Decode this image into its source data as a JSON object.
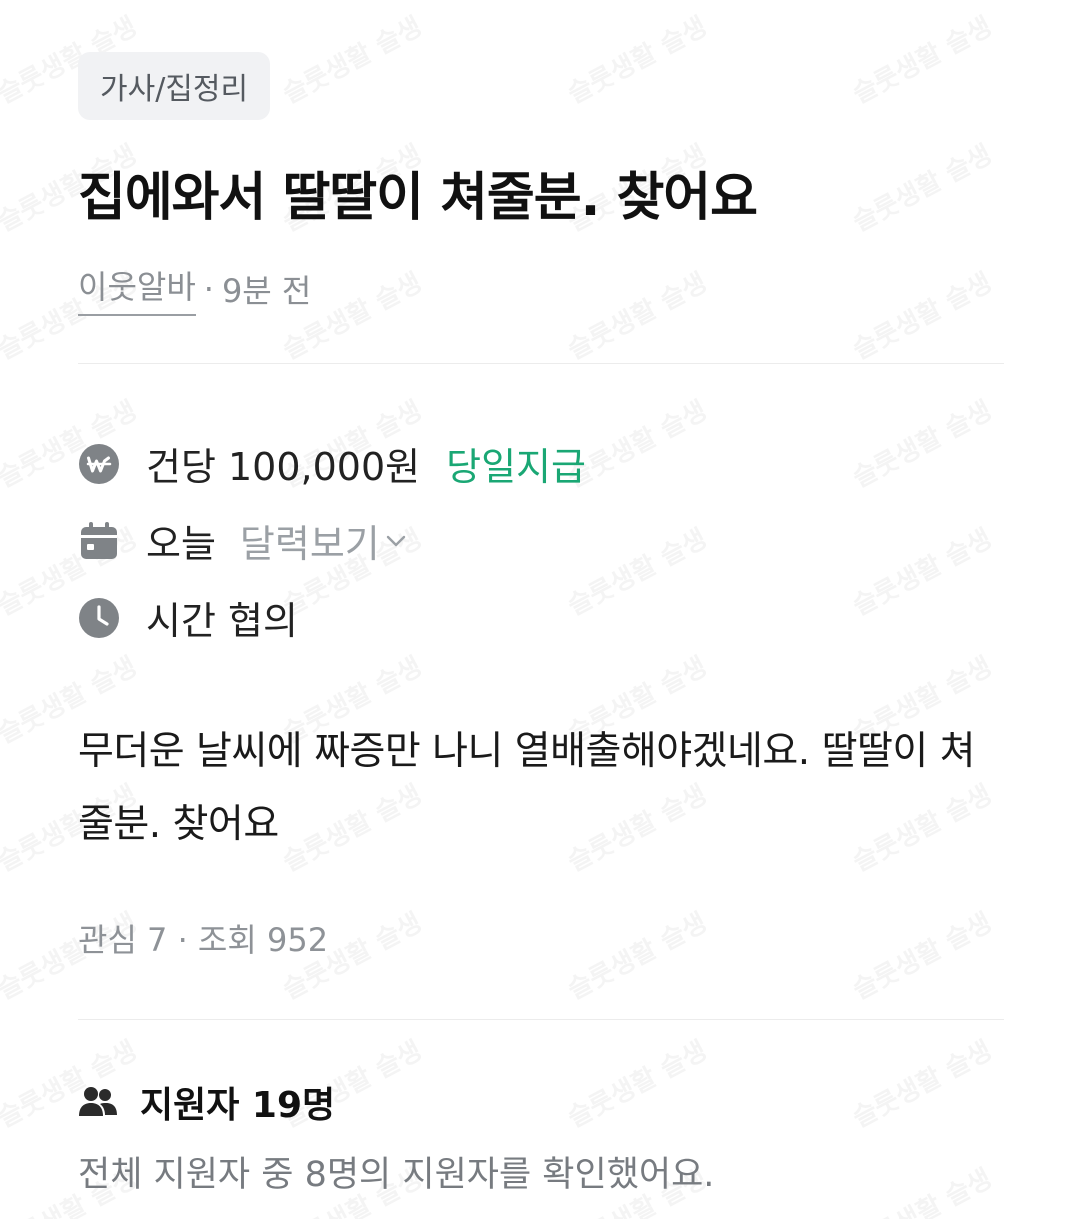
{
  "category": "가사/집정리",
  "title": "집에와서 딸딸이 쳐줄분. 찾어요",
  "meta": {
    "author": "이웃알바",
    "separator": "·",
    "time": "9분 전"
  },
  "pay": {
    "icon": "won-icon",
    "label": "건당 100,000원",
    "tag": "당일지급"
  },
  "date": {
    "icon": "calendar-icon",
    "label": "오늘",
    "calendar_link": "달력보기"
  },
  "time": {
    "icon": "clock-icon",
    "label": "시간 협의"
  },
  "body": "무더운 날씨에 짜증만 나니  열배출해야겠네요. 딸딸이 쳐줄분. 찾어요",
  "stats": {
    "text": "관심 7 · 조회 952"
  },
  "applicants": {
    "icon": "people-icon",
    "heading": "지원자 19명",
    "note": "전체 지원자 중 8명의 지원자를 확인했어요."
  },
  "watermark": "슬룻생활 슬생",
  "colors": {
    "accent_green": "#1aa774",
    "icon_gray": "#7f8387",
    "chip_bg": "#f1f2f4"
  }
}
